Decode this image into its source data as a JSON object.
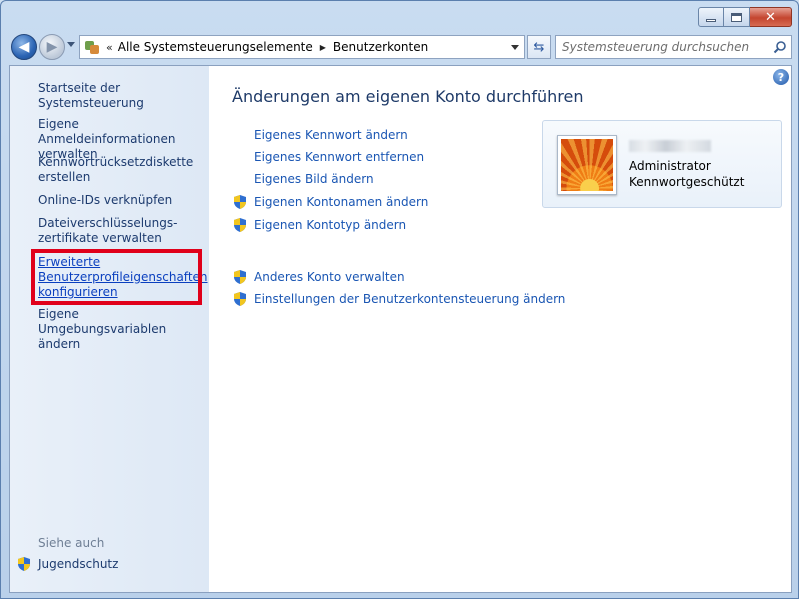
{
  "titlebar": {
    "minimize_icon": "minimize-icon",
    "maximize_icon": "maximize-icon",
    "close_icon": "close-icon"
  },
  "nav": {
    "address": {
      "chevron": "«",
      "crumbs": [
        "Alle Systemsteuerungselemente",
        "Benutzerkonten"
      ]
    },
    "search": {
      "placeholder": "Systemsteuerung durchsuchen"
    }
  },
  "sidebar": {
    "items": [
      {
        "label": "Startseite der Systemsteuerung"
      },
      {
        "label": "Eigene Anmeldeinformationen verwalten"
      },
      {
        "label": "Kennwortrücksetzdiskette erstellen"
      },
      {
        "label": "Online-IDs verknüpfen"
      },
      {
        "label": "Dateiverschlüsselungs-zertifikate verwalten"
      },
      {
        "label": "Erweiterte Benutzerprofileigenschaften konfigurieren"
      },
      {
        "label": "Eigene Umgebungsvariablen ändern"
      }
    ],
    "see_also": "Siehe auch",
    "see_also_items": [
      {
        "label": "Jugendschutz"
      }
    ]
  },
  "main": {
    "title": "Änderungen am eigenen Konto durchführen",
    "tasks": [
      {
        "label": "Eigenes Kennwort ändern",
        "shield": false
      },
      {
        "label": "Eigenes Kennwort entfernen",
        "shield": false
      },
      {
        "label": "Eigenes Bild ändern",
        "shield": false
      },
      {
        "label": "Eigenen Kontonamen ändern",
        "shield": true
      },
      {
        "label": "Eigenen Kontotyp ändern",
        "shield": true
      }
    ],
    "tasks2": [
      {
        "label": "Anderes Konto verwalten",
        "shield": true
      },
      {
        "label": "Einstellungen der Benutzerkontensteuerung ändern",
        "shield": true
      }
    ],
    "account": {
      "type": "Administrator",
      "status": "Kennwortgeschützt"
    }
  },
  "colors": {
    "link": "#1a56b3",
    "highlight_box": "#e0001a",
    "title": "#1e3a68"
  }
}
